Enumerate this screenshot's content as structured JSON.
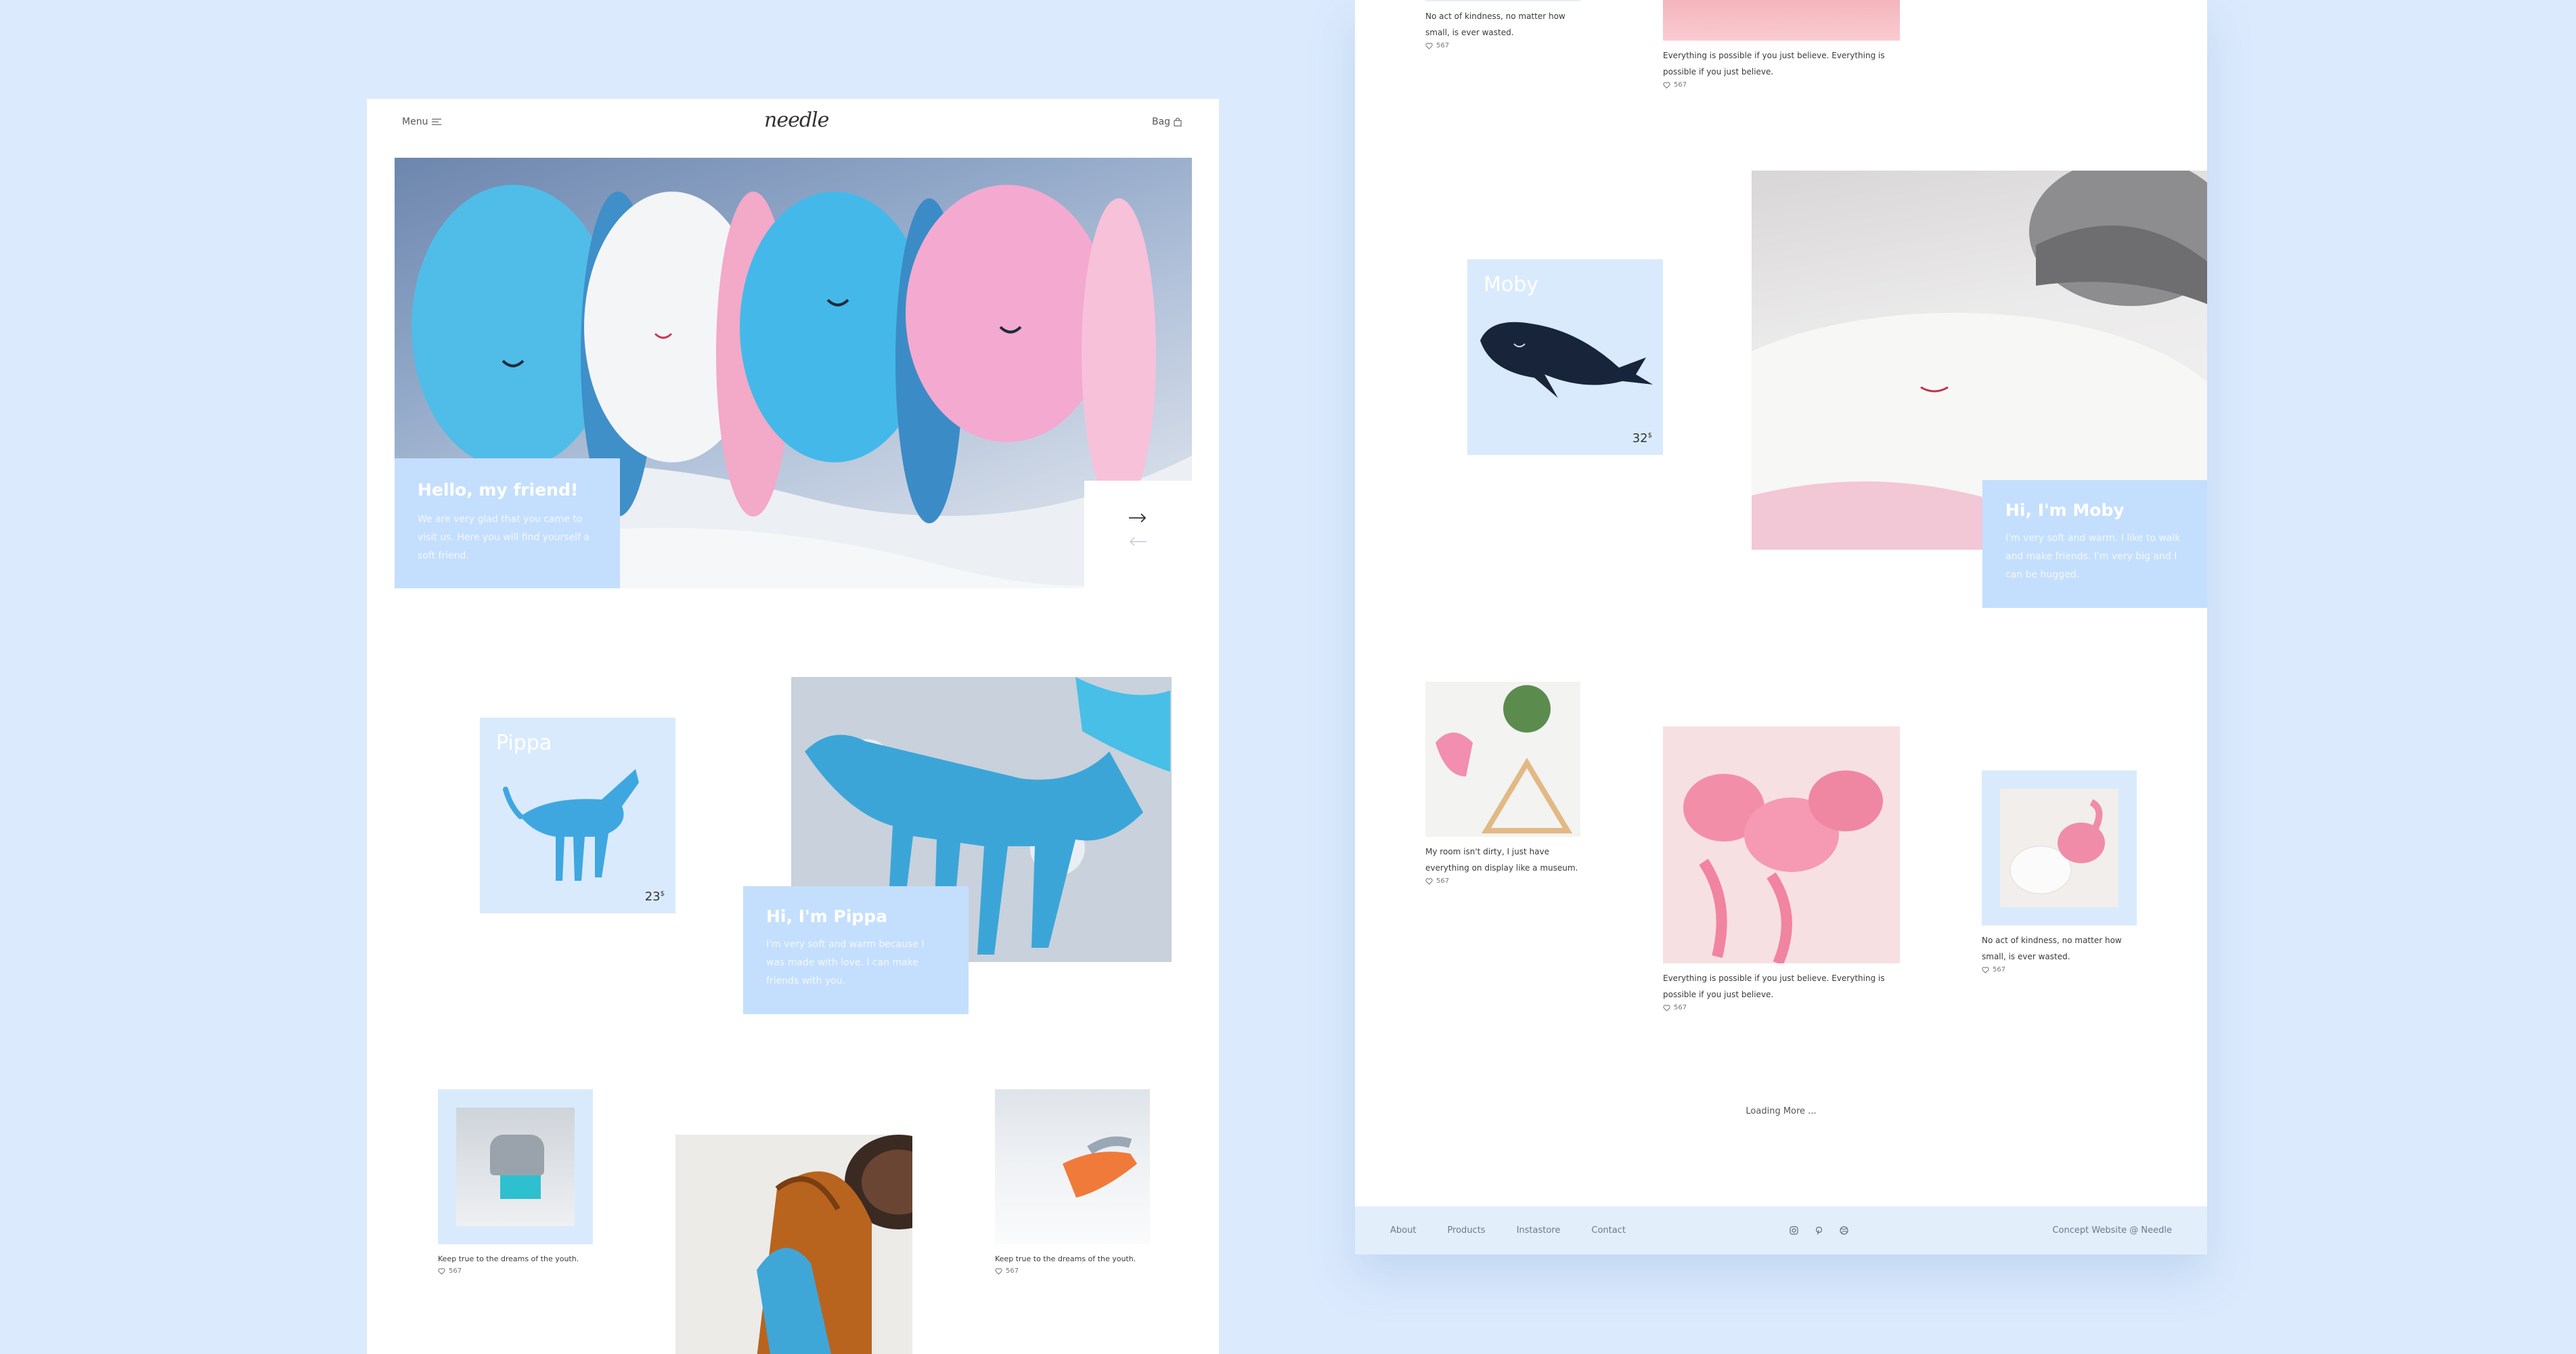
{
  "left": {
    "header": {
      "menu_label": "Menu",
      "logo": "needle",
      "bag_label": "Bag"
    },
    "hero": {
      "heading": "Hello, my friend!",
      "text": "We are very glad that you came to visit us. Here you will find yourself a soft friend."
    },
    "pippa": {
      "name": "Pippa",
      "price": "23",
      "currency": "$",
      "card_heading": "Hi, I'm Pippa",
      "card_text": "I'm very soft and warm because I was made with love. I can make friends with you."
    },
    "posts": [
      {
        "caption": "Keep true to the dreams of the youth.",
        "likes": "567"
      },
      {
        "caption": "Keep true to the dreams of the youth.",
        "likes": "567"
      }
    ]
  },
  "right": {
    "top_posts": [
      {
        "caption": "No act of kindness, no matter how small, is ever wasted.",
        "likes": "567"
      },
      {
        "caption": "Everything is possible if you just believe. Everything is possible if you just believe.",
        "likes": "567"
      }
    ],
    "moby": {
      "name": "Moby",
      "price": "32",
      "currency": "$",
      "card_heading": "Hi, I'm Moby",
      "card_text": "I'm very soft and warm. I like to walk and make friends. I'm very big and I can be hugged."
    },
    "posts": [
      {
        "caption": "My room isn't dirty, I just have everything on display like a museum.",
        "likes": "567"
      },
      {
        "caption": "Everything is possible if you just believe. Everything is possible if you just believe.",
        "likes": "567"
      },
      {
        "caption": "No act of kindness, no matter how small, is ever wasted.",
        "likes": "567"
      }
    ],
    "loading": "Loading More ...",
    "footer": {
      "links": [
        "About",
        "Products",
        "Instastore",
        "Contact"
      ],
      "social_icons": [
        "instagram-icon",
        "pinterest-icon",
        "dribbble-icon"
      ],
      "credit": "Concept Website @ Needle"
    }
  }
}
